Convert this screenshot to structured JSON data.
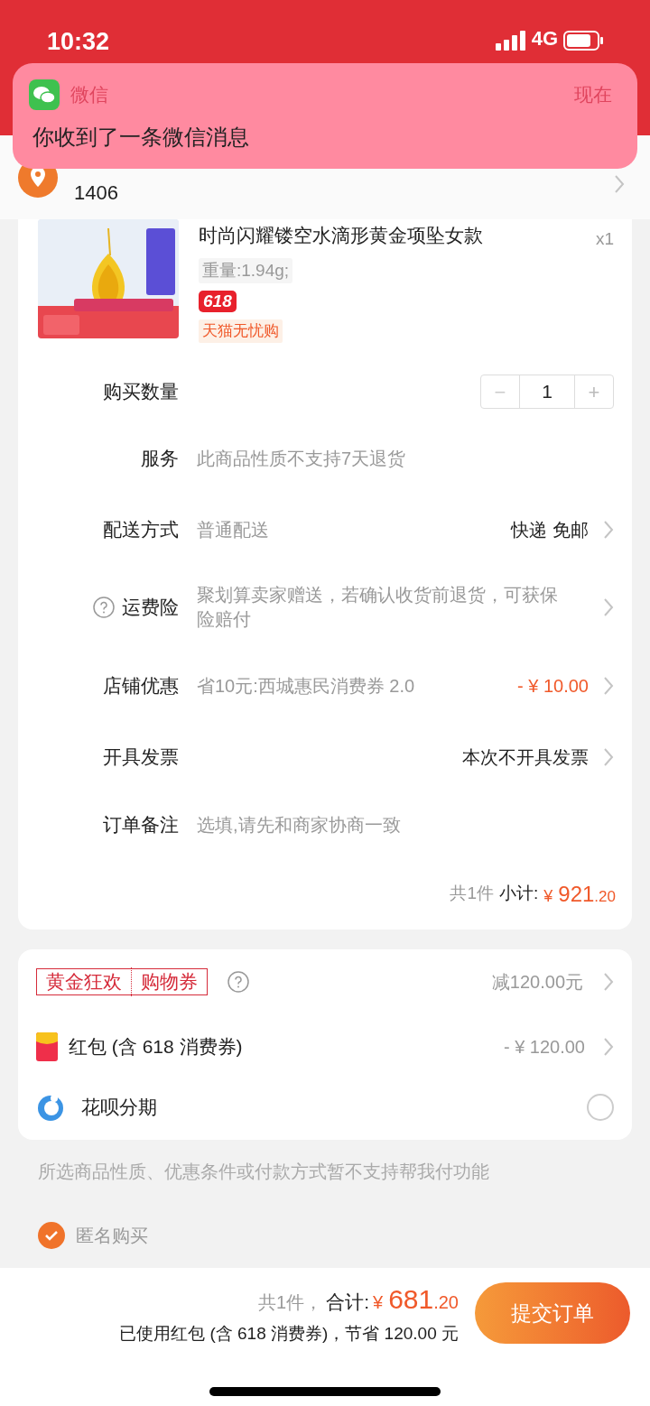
{
  "status_bar": {
    "time": "10:32",
    "network": "4G"
  },
  "notification": {
    "app": "微信",
    "time": "现在",
    "message": "你收到了一条微信消息"
  },
  "address": {
    "line_2": "1406"
  },
  "product": {
    "kind": "picture",
    "title": "时尚闪耀镂空水滴形黄金项坠女款",
    "quantity": "x1",
    "spec": "重量:1.94g;",
    "badge": "618",
    "tag": "天猫无忧购"
  },
  "rows": [
    {
      "kind": "quantity",
      "label": "购买数量",
      "value": "1",
      "minus": "−",
      "plus": "+"
    },
    {
      "kind": "info",
      "label": "服务",
      "value": "此商品性质不支持7天退货"
    },
    {
      "kind": "select",
      "label": "配送方式",
      "value": "普通配送",
      "trailing": "快递 免邮"
    },
    {
      "kind": "help",
      "label": "运费险",
      "value": "聚划算卖家赠送，若确认收货前退货，可获保险赔付"
    },
    {
      "kind": "discount",
      "label": "店铺优惠",
      "value": "省10元:西城惠民消费券 2.0",
      "amount": "- ¥ 10.00"
    },
    {
      "kind": "select",
      "label": "开具发票",
      "trailing": "本次不开具发票"
    },
    {
      "kind": "input",
      "label": "订单备注",
      "placeholder": "选填,请先和商家协商一致"
    }
  ],
  "subtotal": {
    "count": "共1件",
    "label": "小计:",
    "currency": "¥",
    "integer": "921",
    "decimals": ".20"
  },
  "benefits": {
    "coupon_tag": [
      "黄金狂欢",
      "购物券"
    ],
    "coupon_value": "减120.00元",
    "red_packet_label": "红包 (含 618 消费券)",
    "red_packet_amount": "- ¥ 120.00",
    "installment_label": "花呗分期",
    "installment_selected": false
  },
  "notice": "所选商品性质、优惠条件或付款方式暂不支持帮我付功能",
  "anonymous": {
    "label": "匿名购买",
    "checked": true
  },
  "footer": {
    "count": "共1件，",
    "total_label": "合计:",
    "currency": "¥",
    "integer": "681",
    "decimals": ".20",
    "savings": "已使用红包 (含 618 消费券)，节省 120.00 元",
    "submit": "提交订单"
  }
}
